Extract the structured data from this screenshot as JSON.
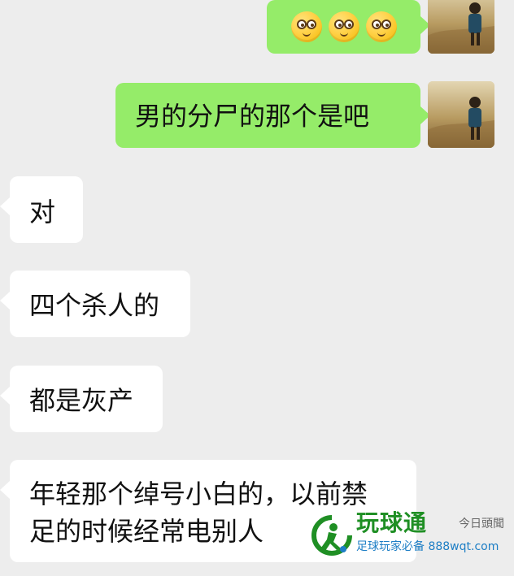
{
  "messages": [
    {
      "side": "right",
      "type": "emoji",
      "emoji": [
        "pleading-face-emoji",
        "pleading-face-emoji",
        "pleading-face-emoji"
      ]
    },
    {
      "side": "right",
      "type": "text",
      "text": "男的分尸的那个是吧"
    },
    {
      "side": "left",
      "type": "text",
      "text": "对"
    },
    {
      "side": "left",
      "type": "text",
      "text": "四个杀人的"
    },
    {
      "side": "left",
      "type": "text",
      "text": "都是灰产"
    },
    {
      "side": "left",
      "type": "text",
      "text_line_1": "年轻那个绰号小白的，以前禁",
      "text_line_2": "足的时候经常电别人"
    }
  ],
  "watermark": {
    "title": "玩球通",
    "subtitle": "足球玩家必备 888wqt.com",
    "source": "今日頭聞"
  },
  "colors": {
    "background": "#ededed",
    "self_bubble": "#95ec69",
    "other_bubble": "#ffffff",
    "watermark_green": "#1f8f24",
    "watermark_blue": "#1d7ec5"
  }
}
